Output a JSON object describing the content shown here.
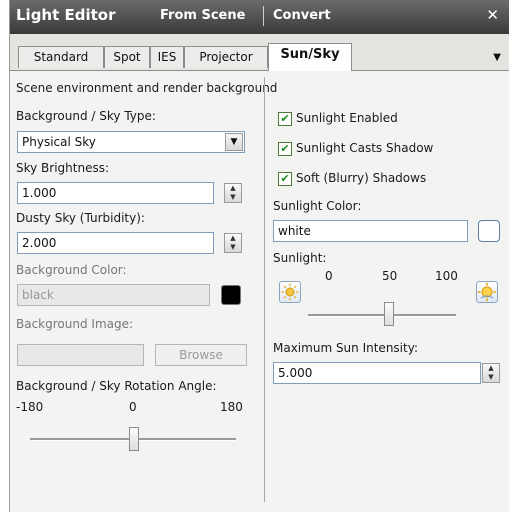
{
  "titlebar": {
    "app_title": "Light Editor",
    "menu_from_scene": "From Scene",
    "menu_convert": "Convert",
    "close_glyph": "✕"
  },
  "tabs": [
    {
      "label": "Standard"
    },
    {
      "label": "Spot"
    },
    {
      "label": "IES"
    },
    {
      "label": "Projector"
    },
    {
      "label": "Sun/Sky",
      "active": true
    }
  ],
  "tab_menu_glyph": "▼",
  "section_description": "Scene environment and render background",
  "left": {
    "sky_type_label": "Background / Sky Type:",
    "sky_type_value": "Physical Sky",
    "sky_brightness_label": "Sky Brightness:",
    "sky_brightness_value": "1.000",
    "turbidity_label": "Dusty Sky (Turbidity):",
    "turbidity_value": "2.000",
    "bg_color_label": "Background Color:",
    "bg_color_value": "black",
    "bg_color_swatch": "#000000",
    "bg_image_label": "Background Image:",
    "bg_image_value": "",
    "browse_label": "Browse",
    "rotation_label": "Background / Sky Rotation Angle:",
    "rotation_min": "-180",
    "rotation_mid": "0",
    "rotation_max": "180",
    "rotation_value": 0
  },
  "right": {
    "sunlight_enabled_label": "Sunlight Enabled",
    "sunlight_enabled_checked": true,
    "casts_shadow_label": "Sunlight Casts Shadow",
    "casts_shadow_checked": true,
    "soft_shadows_label": "Soft (Blurry) Shadows",
    "soft_shadows_checked": true,
    "sun_color_label": "Sunlight Color:",
    "sun_color_value": "white",
    "sun_color_swatch": "#ffffff",
    "sunlight_label": "Sunlight:",
    "sunlight_min": "0",
    "sunlight_mid": "50",
    "sunlight_max": "100",
    "sunlight_value": 50,
    "max_intensity_label": "Maximum Sun Intensity:",
    "max_intensity_value": "5.000"
  },
  "icons": {
    "check_glyph": "✔",
    "spin_up": "▲",
    "spin_down": "▼",
    "dropdown": "▼"
  }
}
